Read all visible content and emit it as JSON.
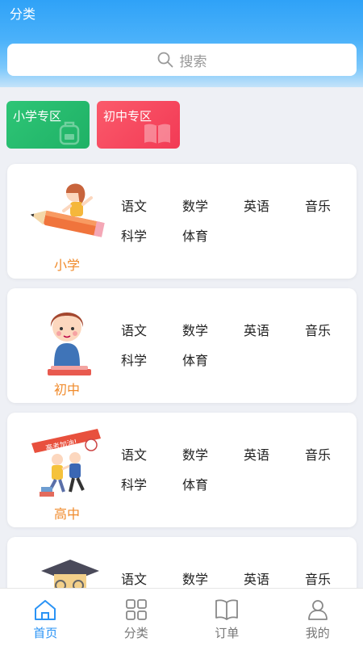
{
  "header": {
    "title": "分类"
  },
  "search": {
    "placeholder": "搜索"
  },
  "zones": [
    {
      "label": "小学专区",
      "color": "#2ec576",
      "icon": "backpack-icon"
    },
    {
      "label": "初中专区",
      "color": "#f23a55",
      "icon": "book-icon"
    }
  ],
  "cards": [
    {
      "grade": "小学",
      "subjects": [
        "语文",
        "数学",
        "英语",
        "音乐",
        "科学",
        "体育"
      ]
    },
    {
      "grade": "初中",
      "subjects": [
        "语文",
        "数学",
        "英语",
        "音乐",
        "科学",
        "体育"
      ]
    },
    {
      "grade": "高中",
      "banner": "高考加油!",
      "subjects": [
        "语文",
        "数学",
        "英语",
        "音乐",
        "科学",
        "体育"
      ]
    },
    {
      "grade": "",
      "subjects": [
        "语文",
        "数学",
        "英语",
        "音乐"
      ]
    }
  ],
  "tabbar": [
    {
      "label": "首页",
      "icon": "home-icon",
      "active": true
    },
    {
      "label": "分类",
      "icon": "grid-icon",
      "active": false
    },
    {
      "label": "订单",
      "icon": "open-book-icon",
      "active": false
    },
    {
      "label": "我的",
      "icon": "person-icon",
      "active": false
    }
  ],
  "colors": {
    "accent": "#2a93f5",
    "grade_label": "#f08a2a",
    "zone_green": "#2ec576",
    "zone_red": "#f23a55"
  }
}
